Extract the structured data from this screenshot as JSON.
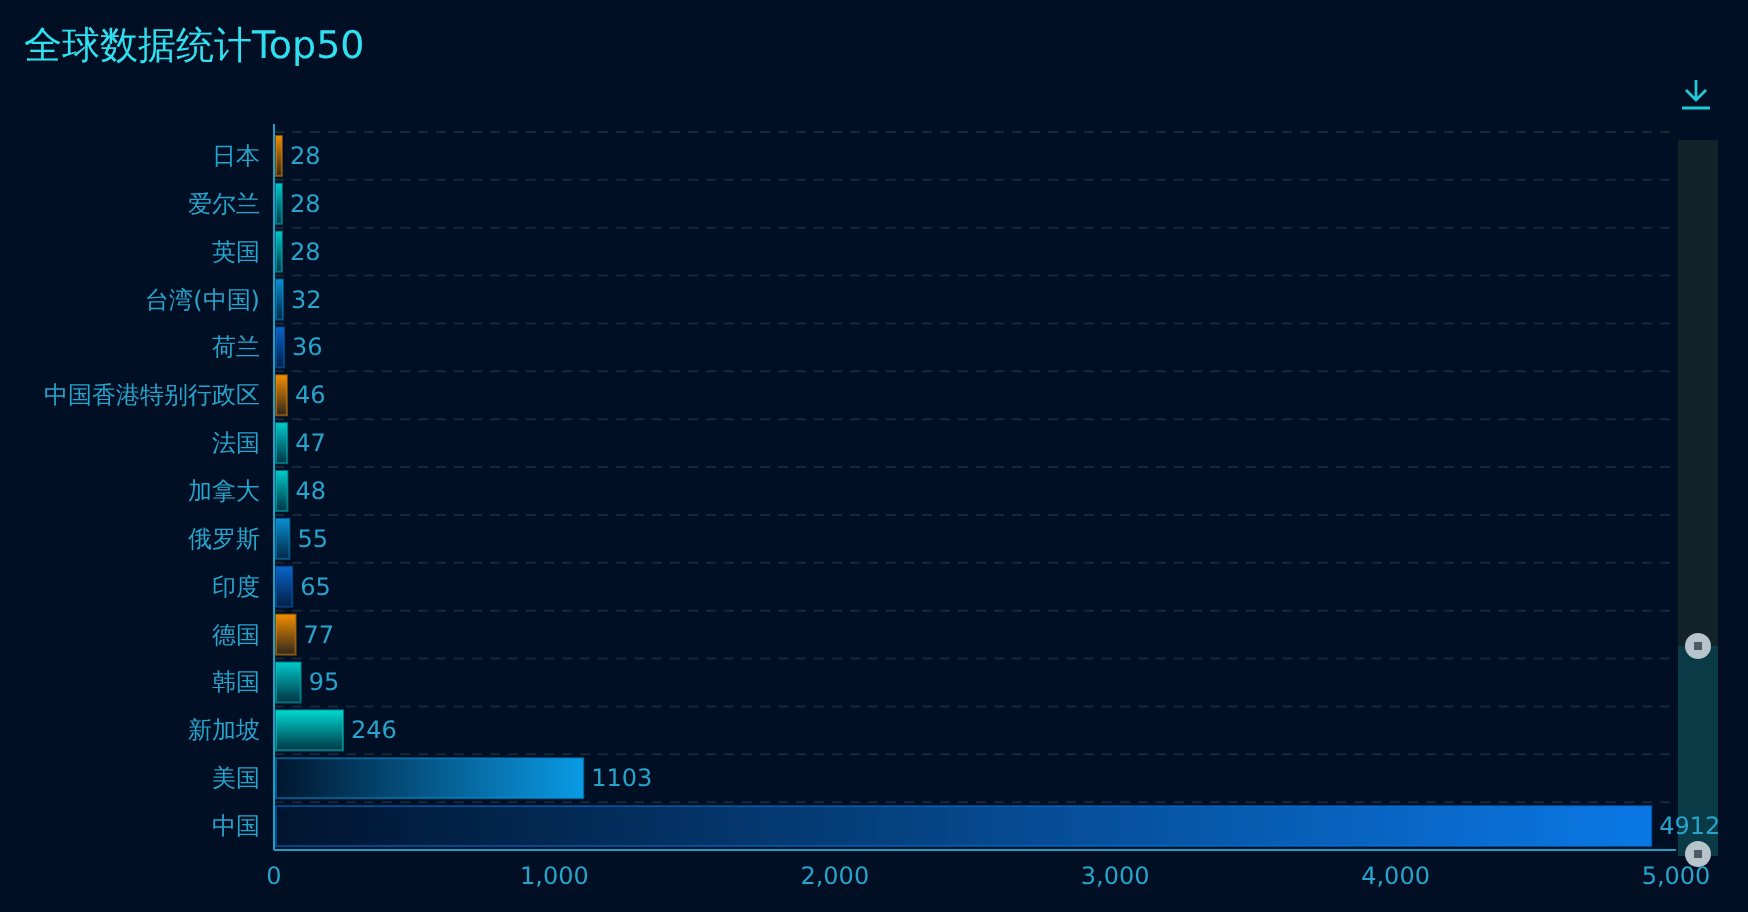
{
  "title": "全球数据统计Top50",
  "chart_data": {
    "type": "bar",
    "orientation": "horizontal",
    "categories": [
      "日本",
      "爱尔兰",
      "英国",
      "台湾(中国)",
      "荷兰",
      "中国香港特别行政区",
      "法国",
      "加拿大",
      "俄罗斯",
      "印度",
      "德国",
      "韩国",
      "新加坡",
      "美国",
      "中国"
    ],
    "series": [
      {
        "values": [
          28,
          28,
          28,
          32,
          36,
          46,
          47,
          48,
          55,
          65,
          77,
          95,
          246,
          1103,
          4912
        ]
      }
    ],
    "colors": [
      "#f08c00",
      "#00c8c8",
      "#00c8c8",
      "#0a8fd0",
      "#0a64c8",
      "#f08c00",
      "#00c8c8",
      "#00c8c8",
      "#0a8fd0",
      "#0a64c8",
      "#f08c00",
      "#00c8c8",
      "#00d8d0",
      "#0a9be6",
      "#0a78e6"
    ],
    "xlim": [
      0,
      5000
    ],
    "xticks": [
      {
        "value": 0,
        "label": "0"
      },
      {
        "value": 1000,
        "label": "1,000"
      },
      {
        "value": 2000,
        "label": "2,000"
      },
      {
        "value": 3000,
        "label": "3,000"
      },
      {
        "value": 4000,
        "label": "4,000"
      },
      {
        "value": 5000,
        "label": "5,000"
      }
    ],
    "data_labels": true
  }
}
